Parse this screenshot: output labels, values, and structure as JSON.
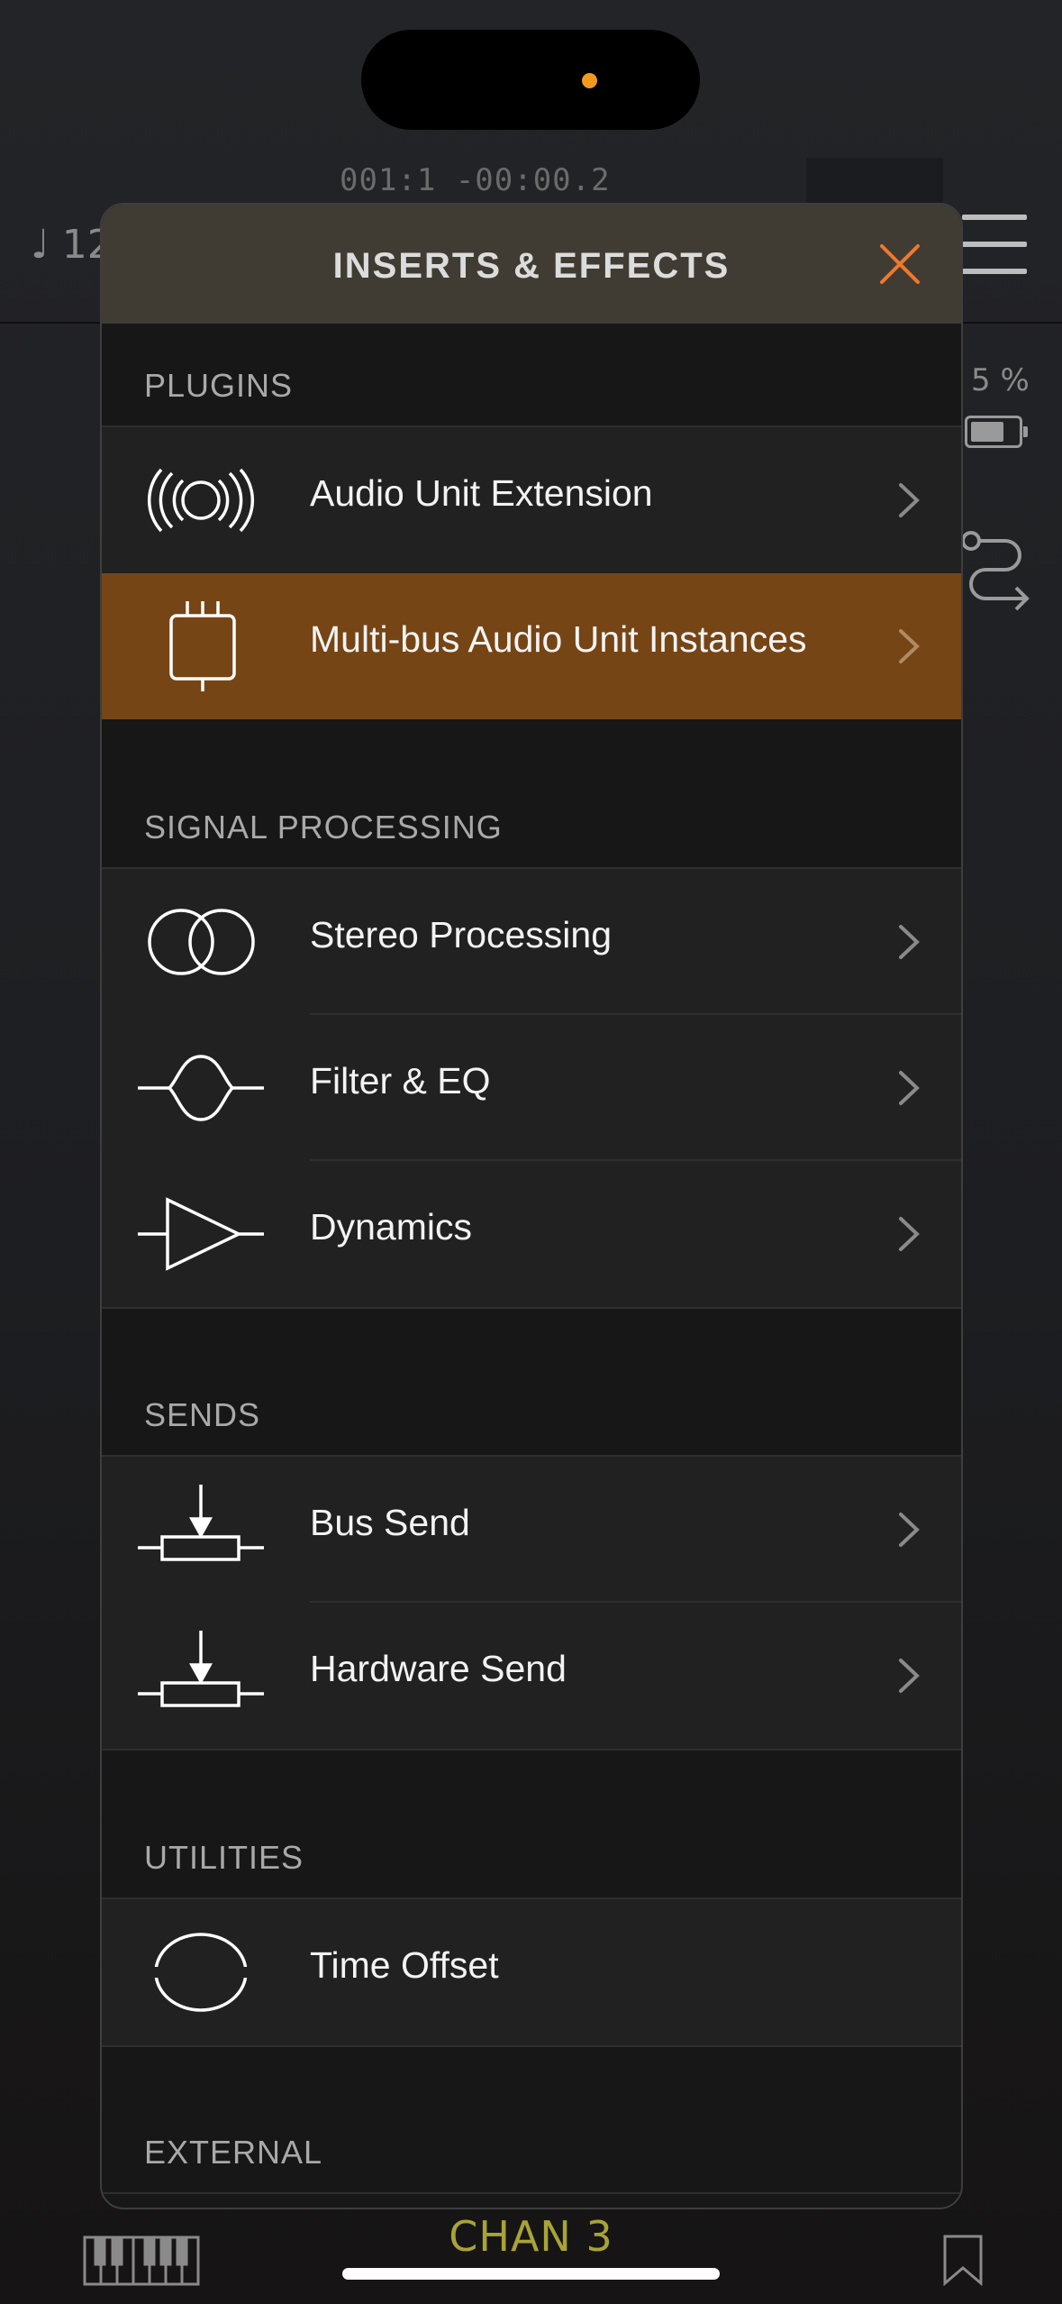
{
  "status": {
    "time_display": "001:1 -00:00.2",
    "tempo": "♩ 12",
    "cpu": "5 %"
  },
  "modal": {
    "title": "INSERTS & EFFECTS",
    "sections": [
      {
        "header": "PLUGINS",
        "items": [
          {
            "label": "Audio Unit Extension",
            "icon": "audio-unit-extension-icon"
          },
          {
            "label": "Multi-bus Audio Unit Instances",
            "icon": "multibus-plug-icon",
            "selected": true
          }
        ]
      },
      {
        "header": "SIGNAL PROCESSING",
        "items": [
          {
            "label": "Stereo Processing",
            "icon": "stereo-circles-icon"
          },
          {
            "label": "Filter & EQ",
            "icon": "filter-eq-icon"
          },
          {
            "label": "Dynamics",
            "icon": "dynamics-triangle-icon"
          }
        ]
      },
      {
        "header": "SENDS",
        "items": [
          {
            "label": "Bus Send",
            "icon": "bus-send-icon"
          },
          {
            "label": "Hardware Send",
            "icon": "hardware-send-icon"
          }
        ]
      },
      {
        "header": "UTILITIES",
        "items": [
          {
            "label": "Time Offset",
            "icon": "time-offset-icon"
          }
        ]
      },
      {
        "header": "EXTERNAL",
        "items": []
      }
    ]
  },
  "footer": {
    "channel": "CHAN 3"
  },
  "colors": {
    "accent": "#f0782d",
    "selected_row": "#764515",
    "channel_text": "#a9a338"
  }
}
